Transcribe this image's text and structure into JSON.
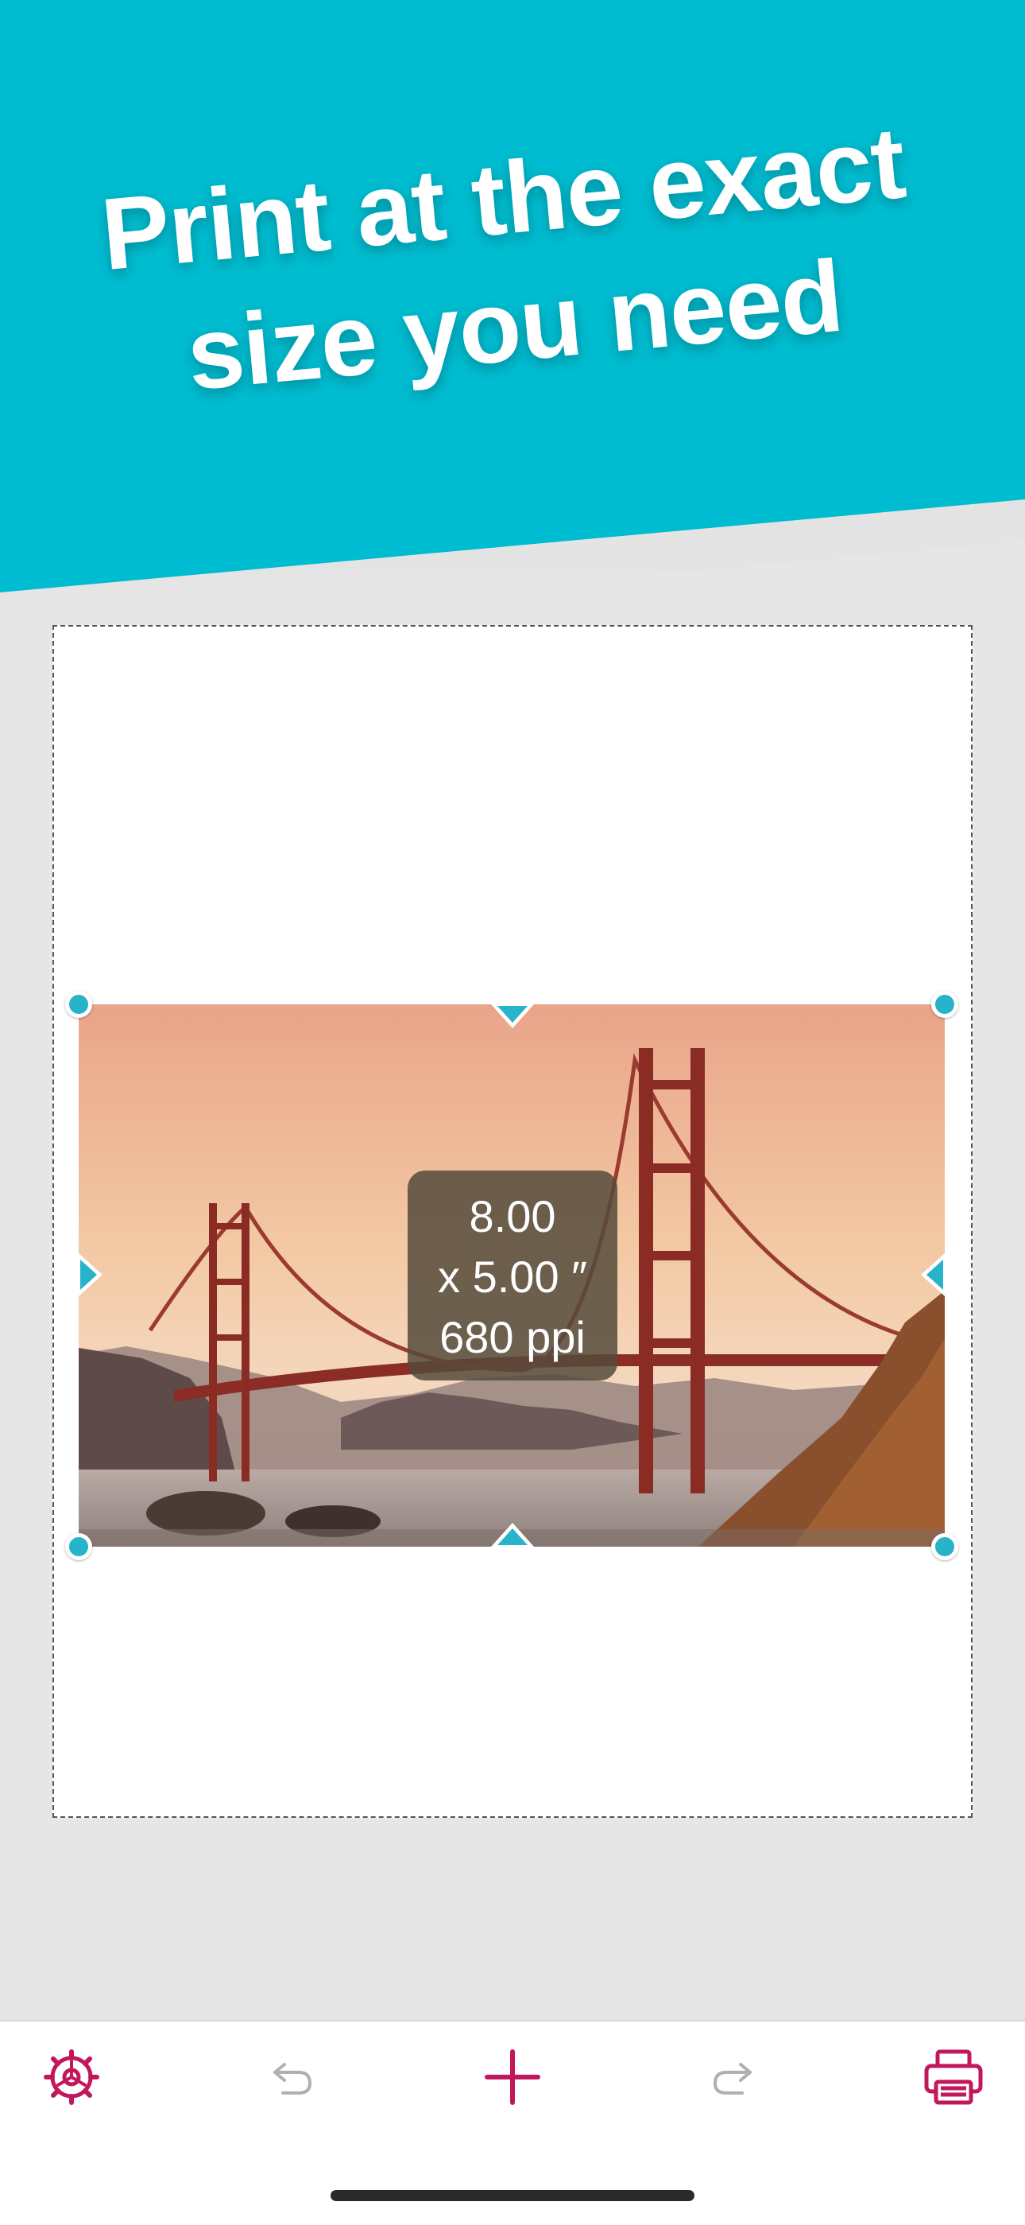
{
  "headline": {
    "line1": "Print at the exact",
    "line2": "size you need"
  },
  "photo": {
    "subject": "Golden Gate Bridge at sunset"
  },
  "dimensions": {
    "width": "8.00",
    "height_line": "x 5.00 ″",
    "resolution": "680 ppi"
  },
  "toolbar": {
    "settings_icon": "gear-icon",
    "undo_icon": "undo-icon",
    "add_icon": "plus-icon",
    "redo_icon": "redo-icon",
    "print_icon": "printer-icon"
  },
  "colors": {
    "header": "#00bcd0",
    "handle": "#27b3c9",
    "accent": "#c2185b",
    "disabled": "#b0b0b0"
  }
}
